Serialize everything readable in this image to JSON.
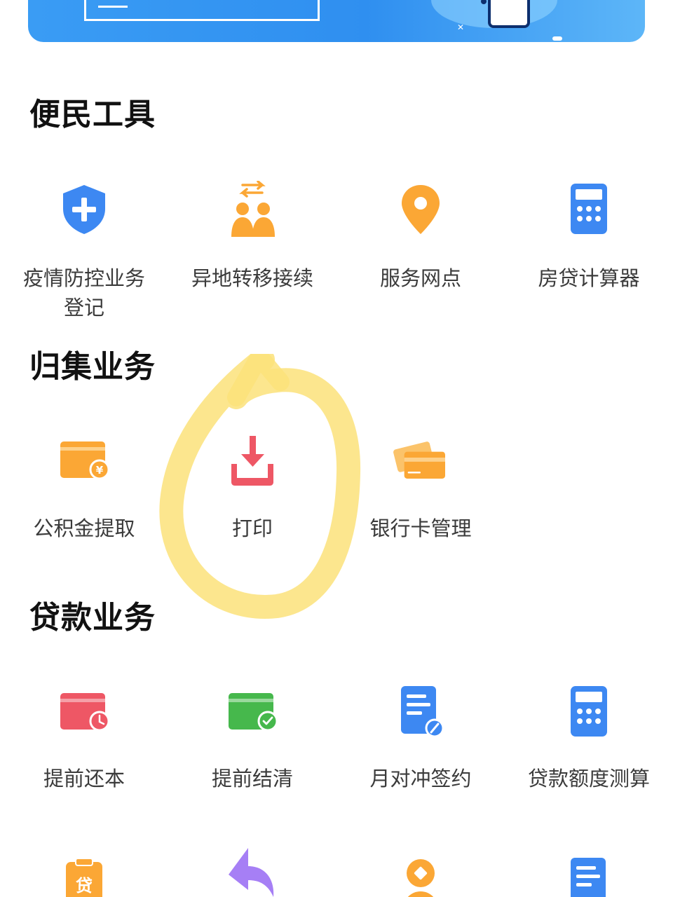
{
  "sections": [
    {
      "title": "便民工具",
      "items": [
        {
          "label": "疫情防控业务登记",
          "icon": "shield-plus-icon"
        },
        {
          "label": "异地转移接续",
          "icon": "people-transfer-icon"
        },
        {
          "label": "服务网点",
          "icon": "location-pin-icon"
        },
        {
          "label": "房贷计算器",
          "icon": "calculator-icon"
        }
      ]
    },
    {
      "title": "归集业务",
      "items": [
        {
          "label": "公积金提取",
          "icon": "yen-card-icon"
        },
        {
          "label": "打印",
          "icon": "download-print-icon"
        },
        {
          "label": "银行卡管理",
          "icon": "bank-cards-icon"
        }
      ]
    },
    {
      "title": "贷款业务",
      "items": [
        {
          "label": "提前还本",
          "icon": "card-clock-icon"
        },
        {
          "label": "提前结清",
          "icon": "card-check-icon"
        },
        {
          "label": "月对冲签约",
          "icon": "document-pen-icon"
        },
        {
          "label": "贷款额度测算",
          "icon": "calculator-icon"
        }
      ]
    }
  ],
  "partial_row": {
    "icons": [
      "loan-clipboard-icon",
      "return-arrow-icon",
      "coin-person-icon",
      "document-icon"
    ],
    "clipboard_char": "贷"
  },
  "colors": {
    "blue": "#3d88f2",
    "orange": "#fba735",
    "red": "#ee5765",
    "green": "#46b84c",
    "purple": "#a67ff5",
    "highlight": "#fbe27a",
    "banner": "#3a9cf4"
  }
}
